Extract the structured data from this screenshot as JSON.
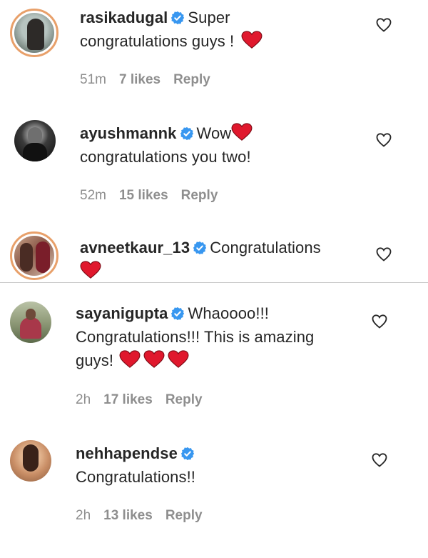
{
  "comments": [
    {
      "username": "rasikadugal",
      "text_line1": "Super",
      "text_line2": "congratulations guys !",
      "time": "51m",
      "likes": "7 likes",
      "reply": "Reply"
    },
    {
      "username": "ayushmannk",
      "text_line1": "Wow",
      "text_line2": "congratulations you two!",
      "time": "52m",
      "likes": "15 likes",
      "reply": "Reply"
    },
    {
      "username": "avneetkaur_13",
      "text_line1": "Congratulations"
    },
    {
      "username": "sayanigupta",
      "text_line1": "Whaoooo!!!",
      "text_line2": "Congratulations!!! This is amazing",
      "text_line3": "guys!",
      "time": "2h",
      "likes": "17 likes",
      "reply": "Reply"
    },
    {
      "username": "nehhapendse",
      "text_line1": "Congratulations!!",
      "time": "2h",
      "likes": "13 likes",
      "reply": "Reply"
    }
  ],
  "colors": {
    "heart_red": "#e0182d",
    "verified_blue": "#3897f0",
    "meta_gray": "#8e8e8e",
    "story_ring": "#e8a06a"
  },
  "icons": {
    "verified": "verified-badge-icon",
    "heart_emoji": "red-heart-emoji",
    "like": "heart-outline-icon"
  }
}
